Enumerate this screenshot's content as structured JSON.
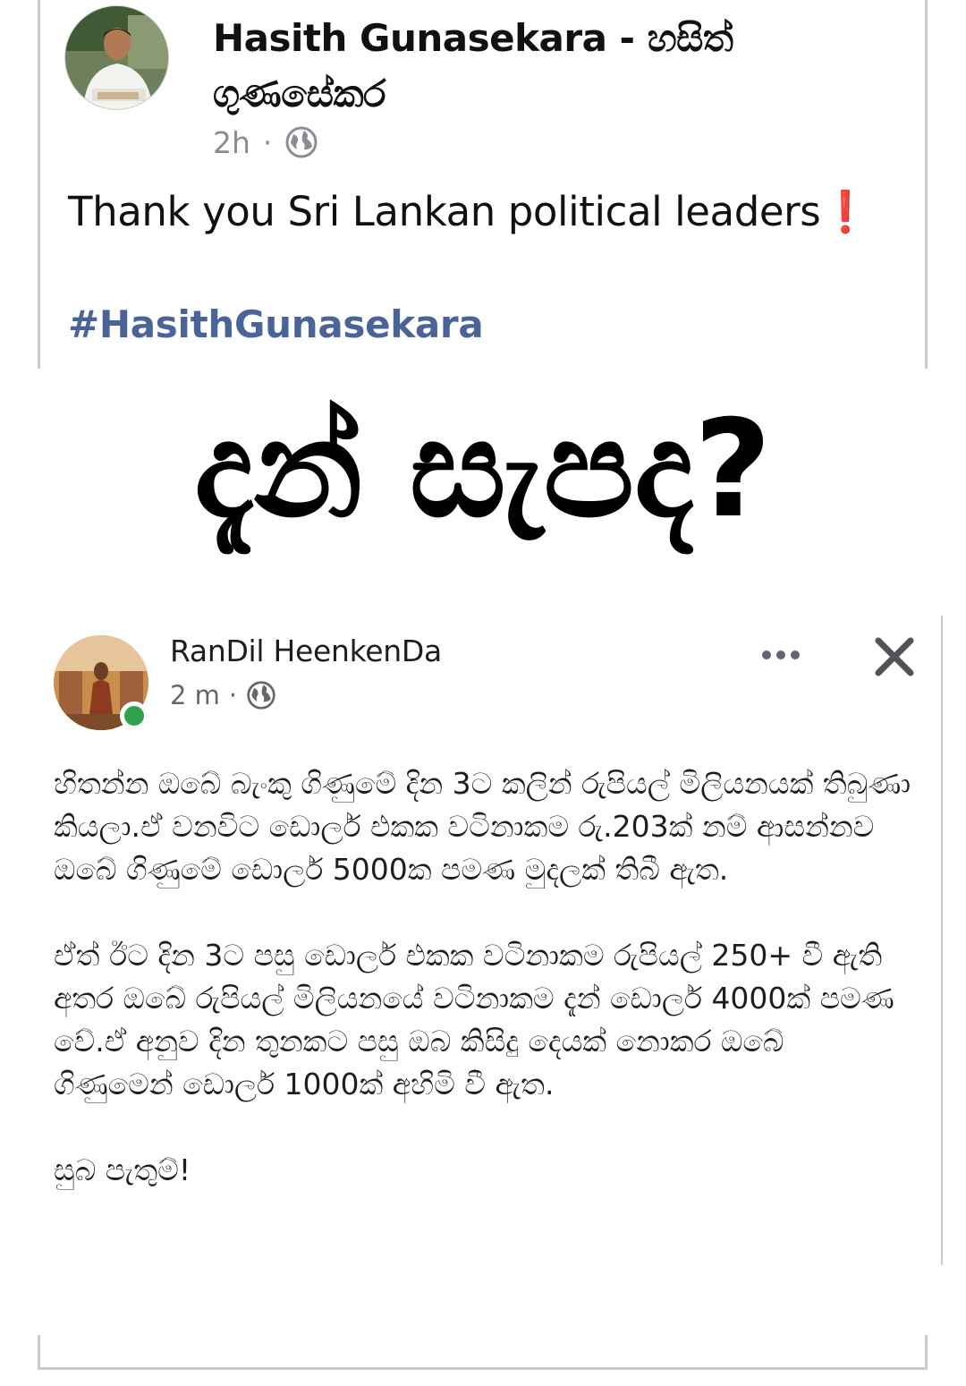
{
  "post": {
    "author": "Hasith Gunasekara  - හසිත් ගුණසේකර",
    "time": "2h",
    "separator": "·",
    "privacy_icon": "globe-icon",
    "text": "Thank you Sri Lankan political leaders❗",
    "hashtag": "#HasithGunasekara"
  },
  "image": {
    "headline": "දැන් සැපද?",
    "shared_post": {
      "author": "RanDil HeenkenDa",
      "time": "2 m",
      "separator": "·",
      "privacy_icon": "globe-icon",
      "more_icon": "more-dots-icon",
      "close_icon": "close-icon",
      "paragraphs": [
        "හිතන්න ඔබේ බැංකු ගිණුමේ දින 3ට කලින් රුපියල් මිලියනයක් තිබුණා කියලා.ඒ වනවිට ඩොලර් එකක වටිනාකම රු.203ක් නම් ආසන්නව ඔබේ ගිණුමේ ඩොලර් 5000ක පමණ මුදලක් තිබී ඇත.",
        "ඒත් ඊට දින 3ට පසු ඩොලර් එකක  වටිනාකම රුපියල් 250+ වී ඇති අතර ඔබේ රුපියල් මිලියනයේ වටිනාකම දැන් ඩොලර් 4000ක් පමණ වේ.ඒ අනුව දින තුනකට පසු ඔබ කිසිදු දෙයක් නොකර ඔබේ ගිණුමෙන් ඩොලර් 1000ක් අහිමි වී ඇත.",
        "සුබ පැතුම්!"
      ],
      "online_status_color": "#31a24c"
    }
  },
  "colors": {
    "hashtag": "#4b6498",
    "meta": "#8a8d91",
    "frame": "#c8cbd0"
  }
}
